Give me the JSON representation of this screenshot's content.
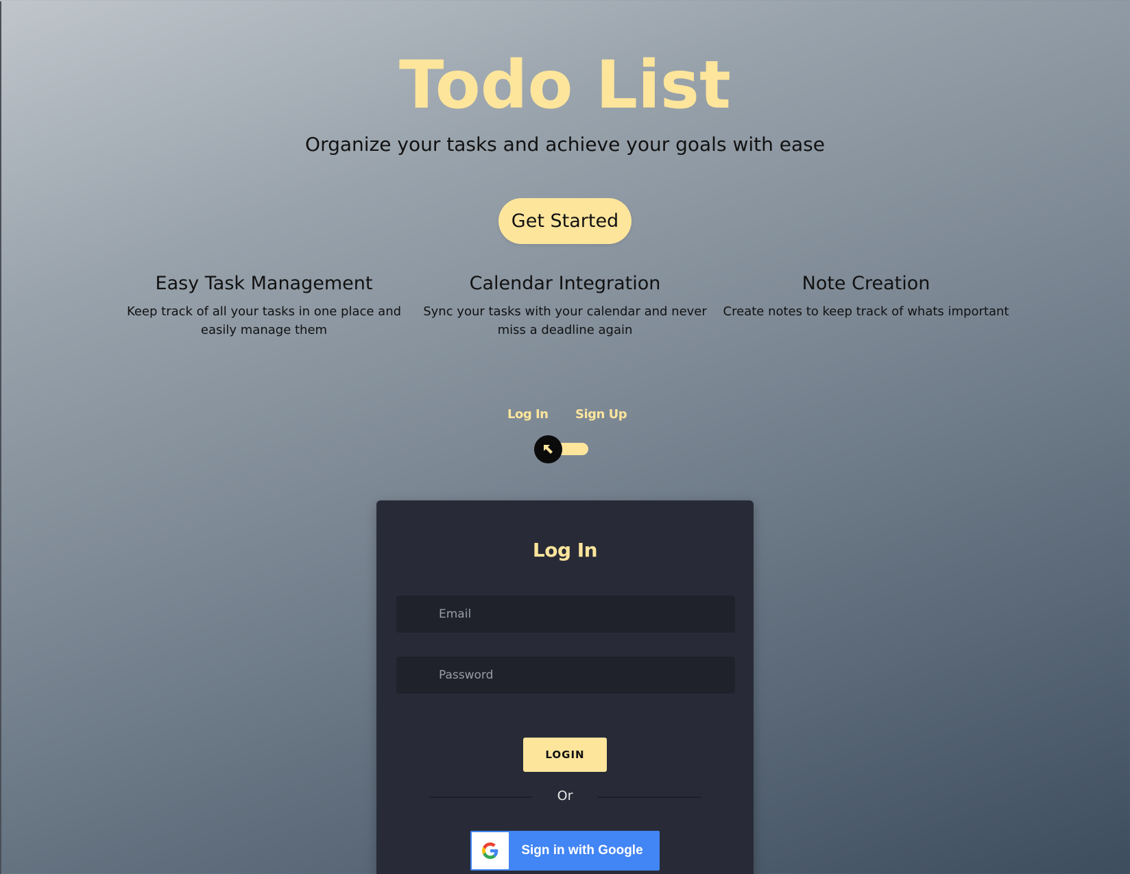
{
  "hero": {
    "title": "Todo List",
    "subtitle": "Organize your tasks and achieve your goals with ease",
    "cta_label": "Get Started"
  },
  "features": [
    {
      "title": "Easy Task Management",
      "description": "Keep track of all your tasks in one place and easily manage them"
    },
    {
      "title": "Calendar Integration",
      "description": "Sync your tasks with your calendar and never miss a deadline again"
    },
    {
      "title": "Note Creation",
      "description": "Create notes to keep track of whats important"
    }
  ],
  "auth_toggle": {
    "login_label": "Log In",
    "signup_label": "Sign Up",
    "selected": "Log In"
  },
  "login_form": {
    "title": "Log In",
    "email_placeholder": "Email",
    "password_placeholder": "Password",
    "submit_label": "LOGIN",
    "divider_text": "Or",
    "google_label": "Sign in with Google"
  },
  "colors": {
    "accent": "#fde59c",
    "card_bg": "#282b37",
    "input_bg": "#1f212b",
    "google_blue": "#4285f4"
  },
  "icons": {
    "toggle_knob": "arrow-up-left-icon",
    "google": "google-logo-icon"
  }
}
